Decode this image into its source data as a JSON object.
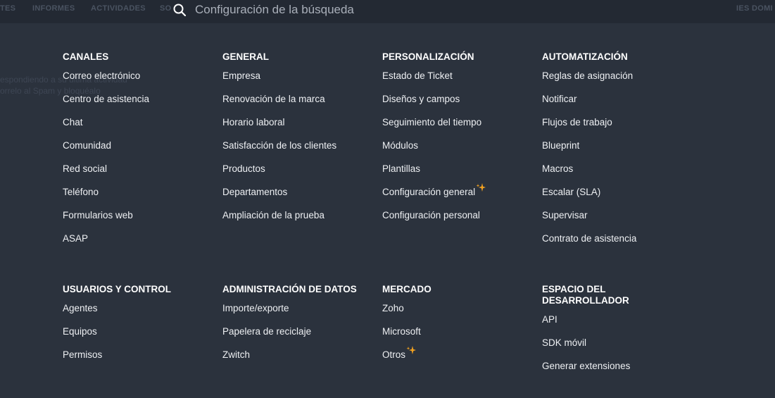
{
  "top_bar": {
    "background_tabs": [
      {
        "id": "tes",
        "label": "TES"
      },
      {
        "id": "informes",
        "label": "INFORMES"
      },
      {
        "id": "actividades",
        "label": "ACTIVIDADES"
      },
      {
        "id": "so",
        "label": "SO"
      },
      {
        "id": "dominio",
        "label": "IES DOMI"
      }
    ],
    "search": {
      "placeholder": "Configuración de la búsqueda",
      "icon": "search-icon"
    }
  },
  "background_text": {
    "line1": "espondiendo a su última actividad",
    "line2": "orrelo al Spam y bloquéalo"
  },
  "colors": {
    "panel_bg": "#2b323d",
    "topbar_bg": "#232933",
    "text": "#eef0f3",
    "sparkle": "#f0a020"
  },
  "sections": {
    "canales": {
      "title": "CANALES",
      "items": [
        "Correo electrónico",
        "Centro de asistencia",
        "Chat",
        "Comunidad",
        "Red social",
        "Teléfono",
        "Formularios web",
        "ASAP"
      ]
    },
    "general": {
      "title": "GENERAL",
      "items": [
        "Empresa",
        "Renovación de la marca",
        "Horario laboral",
        "Satisfacción de los clientes",
        "Productos",
        "Departamentos",
        "Ampliación de la prueba"
      ]
    },
    "personalizacion": {
      "title": "PERSONALIZACIÓN",
      "items": [
        "Estado de Ticket",
        "Diseños y campos",
        "Seguimiento del tiempo",
        "Módulos",
        "Plantillas",
        "Configuración general",
        "Configuración personal"
      ],
      "new_badge_item": "Configuración general"
    },
    "automatizacion": {
      "title": "AUTOMATIZACIÓN",
      "items": [
        "Reglas de asignación",
        "Notificar",
        "Flujos de trabajo",
        "Blueprint",
        "Macros",
        "Escalar (SLA)",
        "Supervisar",
        "Contrato de asistencia"
      ]
    },
    "usuarios": {
      "title": "USUARIOS Y CONTROL",
      "items": [
        "Agentes",
        "Equipos",
        "Permisos"
      ]
    },
    "administracion": {
      "title": "ADMINISTRACIÓN DE DATOS",
      "items": [
        "Importe/exporte",
        "Papelera de reciclaje",
        "Zwitch"
      ]
    },
    "mercado": {
      "title": "MERCADO",
      "items": [
        "Zoho",
        "Microsoft",
        "Otros"
      ],
      "new_badge_item": "Otros"
    },
    "desarrollador": {
      "title_line1": "ESPACIO DEL",
      "title_line2": "DESARROLLADOR",
      "items": [
        "API",
        "SDK móvil",
        "Generar extensiones"
      ]
    }
  }
}
